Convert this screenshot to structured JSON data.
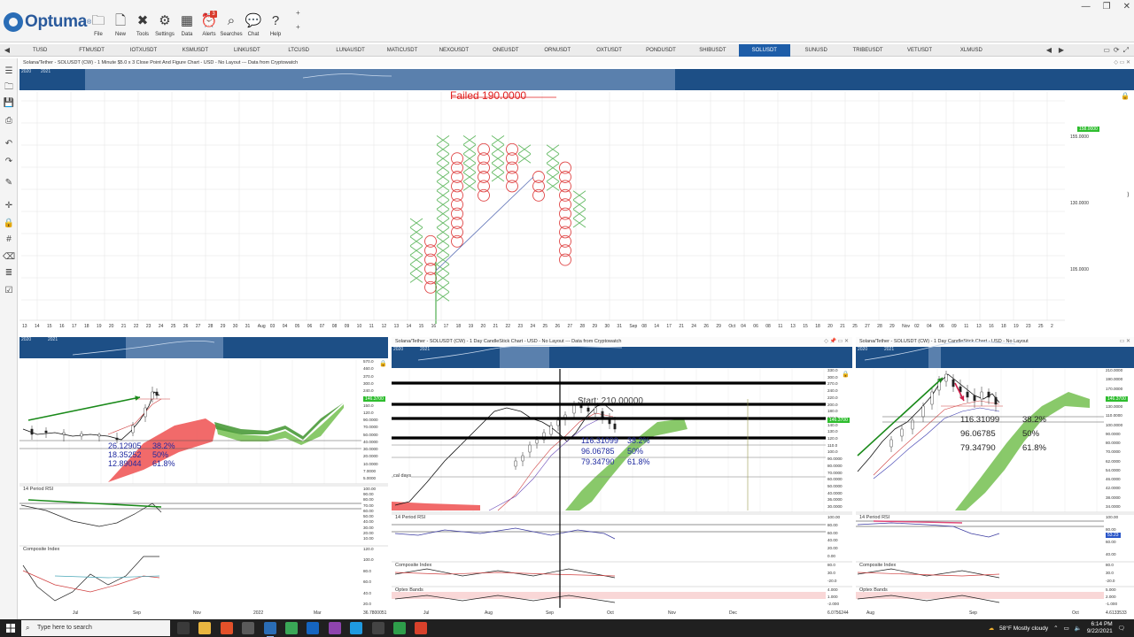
{
  "app": {
    "brand": "Optuma",
    "brand_mark": "®"
  },
  "toolbar": {
    "buttons": [
      {
        "key": "file",
        "label": "File",
        "icon": "folder-icon",
        "glyph": "🗀"
      },
      {
        "key": "new",
        "label": "New",
        "icon": "new-document-icon",
        "glyph": "🗋"
      },
      {
        "key": "tools",
        "label": "Tools",
        "icon": "tools-icon",
        "glyph": "✖"
      },
      {
        "key": "settings",
        "label": "Settings",
        "icon": "gear-icon",
        "glyph": "⚙"
      },
      {
        "key": "data",
        "label": "Data",
        "icon": "binary-data-icon",
        "glyph": "▦"
      },
      {
        "key": "alerts",
        "label": "Alerts",
        "icon": "alarm-clock-icon",
        "glyph": "⏰"
      },
      {
        "key": "searches",
        "label": "Searches",
        "icon": "search-icon",
        "glyph": "⌕"
      },
      {
        "key": "chat",
        "label": "Chat",
        "icon": "chat-bubbles-icon",
        "glyph": "💬"
      },
      {
        "key": "help",
        "label": "Help",
        "icon": "question-mark-icon",
        "glyph": "?"
      }
    ],
    "alerts_badge": "3"
  },
  "window_controls": {
    "minimize": "—",
    "maximize": "❐",
    "close": "✕"
  },
  "tabs": {
    "items": [
      "TUSD",
      "FTMUSDT",
      "IOTXUSDT",
      "KSMUSDT",
      "LINKUSDT",
      "LTCUSD",
      "LUNAUSDT",
      "MATICUSDT",
      "NEXOUSDT",
      "ONEUSDT",
      "ORNUSDT",
      "OXTUSDT",
      "PONDUSDT",
      "SHIBUSDT",
      "SOLUSDT",
      "SUNUSD",
      "TRIBEUSDT",
      "VETUSDT",
      "XLMUSD"
    ],
    "active": "SOLUSDT",
    "nav_left": "◀",
    "nav_right": "▶"
  },
  "sidebar": {
    "icons": [
      {
        "name": "list-icon",
        "glyph": "☰"
      },
      {
        "name": "folder-icon",
        "glyph": "🗀"
      },
      {
        "name": "save-icon",
        "glyph": "💾"
      },
      {
        "name": "print-icon",
        "glyph": "⎙"
      },
      {
        "name": "undo-icon",
        "glyph": "↶"
      },
      {
        "name": "redo-icon",
        "glyph": "↷"
      },
      {
        "name": "pen-tool-icon",
        "glyph": "✎"
      },
      {
        "name": "crosshair-icon",
        "glyph": "✛"
      },
      {
        "name": "lock-icon",
        "glyph": "🔒"
      },
      {
        "name": "grid-icon",
        "glyph": "#"
      },
      {
        "name": "eraser-icon",
        "glyph": "⌫"
      },
      {
        "name": "layers-icon",
        "glyph": "≣"
      },
      {
        "name": "checklist-icon",
        "glyph": "☑"
      }
    ]
  },
  "panes": {
    "top": {
      "title": "Solana/Tether - SOLUSDT (CW) - 1 Minute $5.0 x 3 Close Point And Figure Chart - USD - No Layout --- Data from Cryptowatch",
      "annotation": "Failed 190.0000",
      "price_labels": [
        "155.0000",
        "130.0000",
        "105.0000"
      ],
      "current_price": "158.0000",
      "overview_years": [
        "2020",
        "2021"
      ],
      "date_labels": [
        "13",
        "14",
        "15",
        "16",
        "17",
        "18",
        "19",
        "20",
        "21",
        "22",
        "23",
        "24",
        "25",
        "26",
        "27",
        "28",
        "29",
        "30",
        "31",
        "Aug",
        "03",
        "04",
        "05",
        "06",
        "07",
        "08",
        "09",
        "10",
        "11",
        "12",
        "13",
        "14",
        "15",
        "16",
        "17",
        "18",
        "19",
        "20",
        "21",
        "22",
        "23",
        "24",
        "25",
        "26",
        "27",
        "28",
        "29",
        "30",
        "31",
        "Sep",
        "08",
        "14",
        "17",
        "21",
        "24",
        "26",
        "29",
        "Oct",
        "04",
        "06",
        "08",
        "11",
        "13",
        "15",
        "18",
        "20",
        "21",
        "25",
        "27",
        "28",
        "29",
        "Nov",
        "02",
        "04",
        "06",
        "09",
        "11",
        "13",
        "16",
        "18",
        "19",
        "23",
        "25",
        "2"
      ],
      "axis_close": "⟩"
    },
    "left": {
      "overview_years": [
        "2020",
        "2021"
      ],
      "price_labels": [
        "570.0",
        "460.0",
        "370.0",
        "300.0",
        "240.0",
        "190.0",
        "150.0",
        "120.0",
        "90.0000",
        "70.0000",
        "50.0000",
        "40.0000",
        "30.0000",
        "20.0000",
        "10.0000",
        "7.0000",
        "5.0000"
      ],
      "current_price": "146.3700",
      "fib": [
        {
          "value": "26.12905",
          "pct": "38.2%"
        },
        {
          "value": "18.35252",
          "pct": "50%"
        },
        {
          "value": "12.89044",
          "pct": "61.8%"
        }
      ],
      "rsi_title": "14 Period RSI",
      "rsi_labels": [
        "100.00",
        "90.00",
        "80.00",
        "70.00",
        "60.00",
        "50.00",
        "40.00",
        "30.00",
        "20.00",
        "10.00"
      ],
      "composite_title": "Composite Index",
      "composite_labels": [
        "120.0",
        "100.0",
        "80.0",
        "60.0",
        "40.0",
        "20.0"
      ],
      "date_labels": [
        "Jul",
        "Sep",
        "Nov",
        "2022",
        "Mar"
      ],
      "footer_value": "36.7800051"
    },
    "middle": {
      "title": "Solana/Tether - SOLUSDT (CW) - 1 Day CandleStick Chart - USD - No Layout --- Data from Cryptowatch",
      "overview_years": [
        "2020",
        "2021"
      ],
      "price_labels": [
        "330.0",
        "300.0",
        "270.0",
        "240.0",
        "220.0",
        "200.0",
        "180.0",
        "160.0",
        "140.0",
        "130.0",
        "120.0",
        "110.0",
        "100.0",
        "90.0000",
        "80.0000",
        "70.0000",
        "60.0000",
        "50.0000",
        "40.0000",
        "36.0000",
        "30.0000"
      ],
      "current_price": "146.3700",
      "annotation": "Start: 210.00000",
      "cal_days": "cal days",
      "fib": [
        {
          "value": "116.31099",
          "pct": "38.2%"
        },
        {
          "value": "96.06785",
          "pct": "50%"
        },
        {
          "value": "79.34790",
          "pct": "61.8%"
        }
      ],
      "rsi_title": "14 Period RSI",
      "rsi_labels": [
        "100.00",
        "80.00",
        "60.00",
        "40.00",
        "20.00",
        "0.00"
      ],
      "composite_title": "Composite Index",
      "composite_labels": [
        "80.0",
        "30.0",
        "-20.0"
      ],
      "optex_title": "Optex Bands",
      "optex_labels": [
        "4.000",
        "1.000",
        "-2.000"
      ],
      "date_labels": [
        "Jul",
        "Aug",
        "Sep",
        "Oct",
        "Nov",
        "Dec"
      ],
      "footer_value": "6.0756244"
    },
    "right": {
      "title": "Solana/Tether - SOLUSDT (CW) - 1 Day CandleStick Chart - USD - No Layout",
      "overview_years": [
        "2020",
        "2021"
      ],
      "price_labels": [
        "210.0000",
        "190.0000",
        "170.0000",
        "150.0000",
        "130.0000",
        "110.0000",
        "100.0000",
        "90.0000",
        "80.0000",
        "70.0000",
        "62.0000",
        "54.0000",
        "46.0000",
        "42.0000",
        "38.0000",
        "34.0000"
      ],
      "current_price": "146.3700",
      "fib": [
        {
          "value": "116.31099",
          "pct": "38.2%"
        },
        {
          "value": "96.06785",
          "pct": "50%"
        },
        {
          "value": "79.34790",
          "pct": "61.8%"
        }
      ],
      "rsi_title": "14 Period RSI",
      "rsi_labels": [
        "100.00",
        "80.00",
        "60.00",
        "40.00"
      ],
      "rsi_value": "53.23",
      "composite_title": "Composite Index",
      "composite_labels": [
        "80.0",
        "30.0",
        "-20.0"
      ],
      "optex_title": "Optex Bands",
      "optex_labels": [
        "5.000",
        "2.000",
        "-1.000"
      ],
      "date_labels": [
        "Aug",
        "Sep",
        "Oct"
      ],
      "footer_value": "4.6133533"
    }
  },
  "colors": {
    "brand_blue": "#1d5da8",
    "overview_blue": "#1d4f86",
    "pf_x": "#66bb66",
    "pf_o": "#e04848",
    "annotation_red": "#e02020",
    "cloud_green": "#7cc35a",
    "cloud_red": "#f05a5a",
    "trend_green": "#1a8a1a",
    "fib_text": "#1f2aa0"
  },
  "taskbar": {
    "search_placeholder": "Type here to search",
    "weather": "58°F  Mostly cloudy",
    "time": "6:14 PM",
    "date": "9/22/2021",
    "apps": [
      {
        "name": "task-view-icon",
        "color": "#3a3a3a"
      },
      {
        "name": "file-explorer-icon",
        "color": "#e9b640"
      },
      {
        "name": "brave-browser-icon",
        "color": "#e2512a"
      },
      {
        "name": "calculator-icon",
        "color": "#5a5a5a"
      },
      {
        "name": "optuma-app-icon",
        "color": "#2a6db6"
      },
      {
        "name": "chrome-icon",
        "color": "#3aa757"
      },
      {
        "name": "outlook-icon",
        "color": "#1565c0"
      },
      {
        "name": "media-player-icon",
        "color": "#8e44ad"
      },
      {
        "name": "network-app-icon",
        "color": "#1f9ae0"
      },
      {
        "name": "obs-icon",
        "color": "#444444"
      },
      {
        "name": "green-app-icon",
        "color": "#2e9e4a"
      },
      {
        "name": "snip-tool-icon",
        "color": "#d8412b"
      }
    ]
  }
}
